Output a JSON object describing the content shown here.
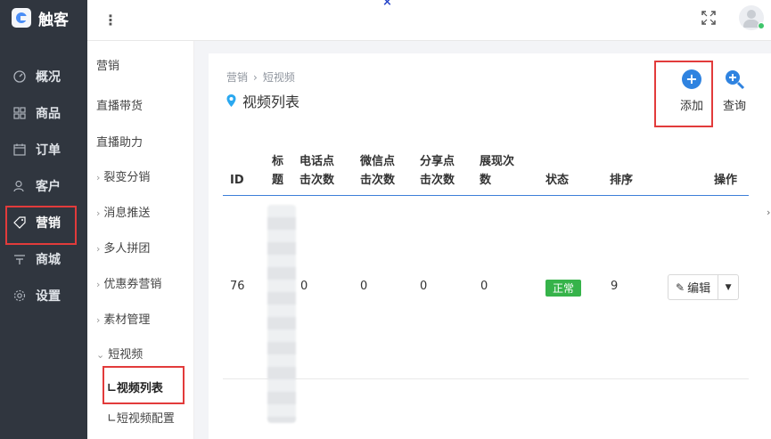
{
  "app": {
    "logo_text": "触客"
  },
  "nav": {
    "items": [
      {
        "label": "概况",
        "icon": "gauge-icon"
      },
      {
        "label": "商品",
        "icon": "grid-icon"
      },
      {
        "label": "订单",
        "icon": "calendar-icon"
      },
      {
        "label": "客户",
        "icon": "user-icon"
      },
      {
        "label": "营销",
        "icon": "tag-icon"
      },
      {
        "label": "商城",
        "icon": "shop-icon"
      },
      {
        "label": "设置",
        "icon": "gear-icon"
      }
    ],
    "active": "营销"
  },
  "submenu": {
    "header": "营销",
    "items": [
      "直播带货",
      "直播助力",
      "裂变分销",
      "消息推送",
      "多人拼团",
      "优惠券营销",
      "素材管理",
      "短视频"
    ],
    "children": [
      "∟视频列表",
      "∟短视频配置"
    ]
  },
  "breadcrumb": {
    "root": "营销",
    "current": "短视频"
  },
  "page": {
    "title": "视频列表"
  },
  "toolbar": {
    "add_label": "添加",
    "search_label": "查询"
  },
  "table": {
    "headers": {
      "id": "ID",
      "title": "标题",
      "phone": "电话点击次数",
      "wechat": "微信点击次数",
      "share": "分享点击次数",
      "views": "展现次数",
      "status": "状态",
      "sort": "排序",
      "ops": "操作"
    },
    "rows": [
      {
        "id": "76",
        "phone": "0",
        "wechat": "0",
        "share": "0",
        "views": "0",
        "status": "正常",
        "sort": "9",
        "edit": "编辑"
      }
    ]
  },
  "colors": {
    "accent": "#2f83e0",
    "status_ok": "#36b34a",
    "highlight": "#e23b3b",
    "sidebar": "#30363f"
  }
}
